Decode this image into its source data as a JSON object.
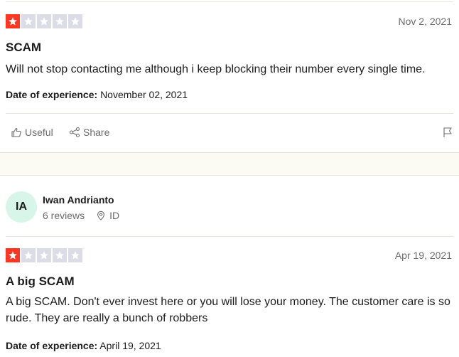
{
  "reviews": [
    {
      "rating": 1,
      "max_rating": 5,
      "date": "Nov 2, 2021",
      "title": "SCAM",
      "body": "Will not stop contacting me although i keep blocking their number every single time.",
      "experience_label": "Date of experience:",
      "experience_date": "November 02, 2021",
      "useful_label": "Useful",
      "share_label": "Share"
    },
    {
      "reviewer": {
        "initials": "IA",
        "name": "Iwan Andrianto",
        "reviews_count": "6 reviews",
        "country": "ID"
      },
      "rating": 1,
      "max_rating": 5,
      "date": "Apr 19, 2021",
      "title": "A big SCAM",
      "body": "A big SCAM. Don't ever invest here or you will lose your money. The customer care is so rude. They are really a bunch of robbers",
      "experience_label": "Date of experience:",
      "experience_date": "April 19, 2021"
    }
  ],
  "icons": {
    "star": "star-icon",
    "useful": "thumbs-up-icon",
    "share": "share-icon",
    "flag": "flag-icon",
    "location": "location-pin-icon"
  },
  "colors": {
    "star_on": "#ff3722",
    "star_off": "#dcdce6",
    "avatar_bg": "#d7f5e8",
    "separator_bg": "#fcfbf3"
  }
}
